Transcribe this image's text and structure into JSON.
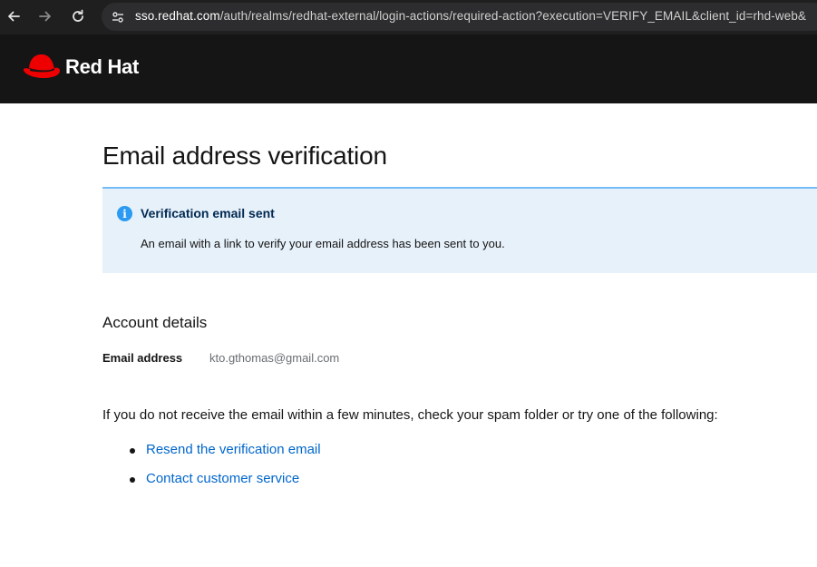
{
  "browser": {
    "url_host": "sso.redhat.com",
    "url_path": "/auth/realms/redhat-external/login-actions/required-action?execution=VERIFY_EMAIL&client_id=rhd-web&"
  },
  "header": {
    "brand": "Red Hat",
    "brand_color": "#ee0000"
  },
  "main": {
    "title": "Email address verification",
    "alert": {
      "title": "Verification email sent",
      "message": "An email with a link to verify your email address has been sent to you."
    },
    "account_details": {
      "heading": "Account details",
      "email_label": "Email address",
      "email_value": "kto.gthomas@gmail.com"
    },
    "help_text": "If you do not receive the email within a few minutes, check your spam folder or try one of the following:",
    "options": [
      {
        "label": "Resend the verification email"
      },
      {
        "label": "Contact customer service"
      }
    ]
  }
}
